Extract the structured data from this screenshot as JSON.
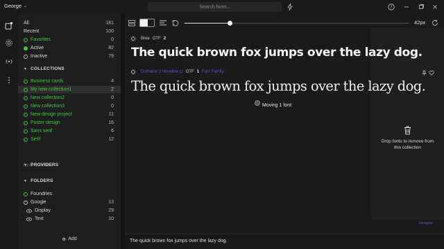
{
  "titlebar": {
    "user": "George",
    "search_placeholder": "Search fonts..."
  },
  "sidebar": {
    "library": [
      {
        "label": "All",
        "count": "181"
      },
      {
        "label": "Recent",
        "count": "100"
      },
      {
        "label": "Favorites",
        "count": "0"
      },
      {
        "label": "Active",
        "count": "82"
      },
      {
        "label": "Inactive",
        "count": "79"
      }
    ],
    "collections_header": "COLLECTIONS",
    "collections": [
      {
        "label": "Business cards",
        "count": "4"
      },
      {
        "label": "My new collection1",
        "count": "2"
      },
      {
        "label": "New collection2",
        "count": "0"
      },
      {
        "label": "New collection3",
        "count": "0"
      },
      {
        "label": "New design project",
        "count": "11"
      },
      {
        "label": "Poster design",
        "count": "16"
      },
      {
        "label": "Sans serif",
        "count": "6"
      },
      {
        "label": "Serif",
        "count": "12"
      }
    ],
    "new_collection": "New collection",
    "providers_header": "PROVIDERS",
    "folders_header": "FOLDERS",
    "folders": [
      {
        "label": "Foundries",
        "count": ""
      },
      {
        "label": "Google",
        "count": "13"
      },
      {
        "label": "Display",
        "count": "29"
      },
      {
        "label": "Text",
        "count": "10"
      }
    ],
    "add_label": "Add"
  },
  "toolbar": {
    "size_label": "42px",
    "size_fraction": 0.2
  },
  "fonts": [
    {
      "name": "Bree",
      "format": "OTF",
      "count": "2",
      "preview": "The quick brown fox jumps over the lazy dog."
    },
    {
      "name": "Domaine 3 Hoveline Lt",
      "format": "OTF",
      "count": "1",
      "tag": "Font Family",
      "preview": "The quick brown fox jumps over the lazy dog."
    }
  ],
  "drag_tooltip": "Moving 1 font",
  "drop_panel": {
    "text": "Drop fonts to remove from this collection"
  },
  "corner_link": "Designer",
  "bottombar": {
    "sample_text": "The quick brown fox jumps over the lazy dog."
  },
  "colors": {
    "active_green": "#3fc93f",
    "accent_purple": "#6b4fd8",
    "background": "#161616"
  }
}
